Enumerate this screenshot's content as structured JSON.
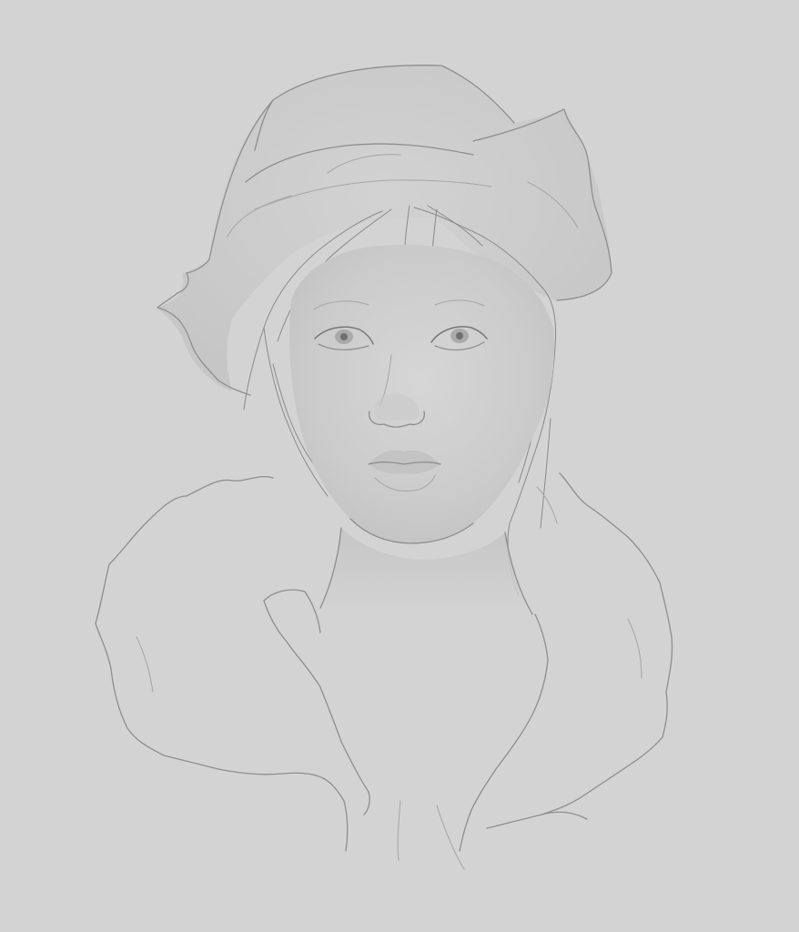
{
  "canvas": {
    "background_color": "#d3d3d3",
    "line_color": "#8e8e8e",
    "shade_color": "#c6c6c6"
  },
  "artwork": {
    "subject_icons": [
      "fur-hat-icon",
      "face-icon",
      "hair-icon",
      "neck-icon",
      "fur-collar-icon"
    ]
  }
}
